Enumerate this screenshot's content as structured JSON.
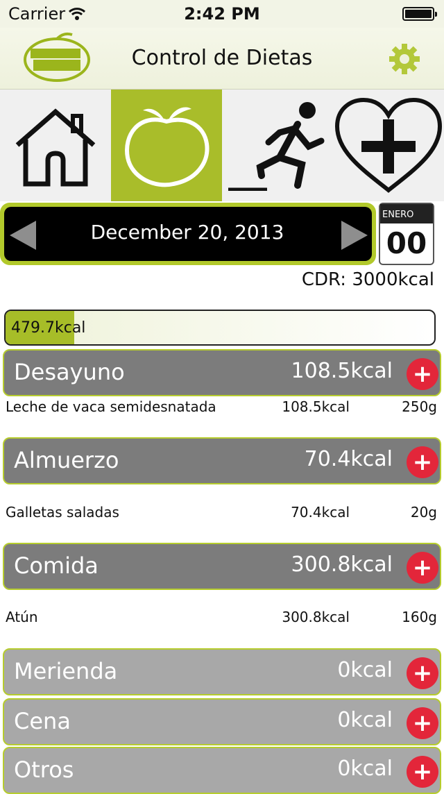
{
  "status_bar": {
    "carrier": "Carrier",
    "time": "2:42 PM"
  },
  "nav": {
    "logo_text": "CONTROL DE Dietas",
    "title": "Control de Dietas"
  },
  "tabs": [
    {
      "icon": "home-icon",
      "selected": false
    },
    {
      "icon": "apple-icon",
      "selected": true
    },
    {
      "icon": "runner-icon",
      "selected": false
    },
    {
      "icon": "heart-plus-icon",
      "selected": false
    }
  ],
  "date_bar": {
    "date": "December 20, 2013",
    "calendar_month": "ENERO",
    "calendar_day": "00"
  },
  "cdr": "CDR: 3000kcal",
  "progress": {
    "label": "479.7kcal",
    "fraction": 0.16
  },
  "meals": [
    {
      "name": "Desayuno",
      "kcal": "108.5kcal",
      "items": [
        {
          "name": "Leche de vaca semidesnatada",
          "kcal": "108.5kcal",
          "grams": "250g"
        }
      ]
    },
    {
      "name": "Almuerzo",
      "kcal": "70.4kcal",
      "items": [
        {
          "name": "Galletas saladas",
          "kcal": "70.4kcal",
          "grams": "20g"
        }
      ]
    },
    {
      "name": "Comida",
      "kcal": "300.8kcal",
      "items": [
        {
          "name": "Atún",
          "kcal": "300.8kcal",
          "grams": "160g"
        }
      ]
    },
    {
      "name": "Merienda",
      "kcal": "0kcal",
      "items": []
    },
    {
      "name": "Cena",
      "kcal": "0kcal",
      "items": []
    },
    {
      "name": "Otros",
      "kcal": "0kcal",
      "items": []
    }
  ],
  "add_label": "+",
  "colors": {
    "accent": "#a9bd2a",
    "dark_row": "#7c7c7c",
    "light_row": "#a8a8a8",
    "add_button": "#e3263a"
  }
}
